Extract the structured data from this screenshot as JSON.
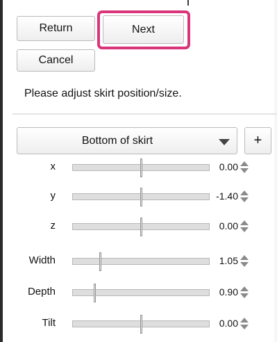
{
  "buttons": {
    "return_label": "Return",
    "next_label": "Next",
    "cancel_label": "Cancel",
    "add_label": "+"
  },
  "message": "Please adjust skirt position/size.",
  "part_selector": {
    "selected": "Bottom of skirt"
  },
  "sliders": [
    {
      "label": "x",
      "value": "0.00",
      "position": 0.5
    },
    {
      "label": "y",
      "value": "-1.40",
      "position": 0.5
    },
    {
      "label": "z",
      "value": "0.00",
      "position": 0.5
    },
    {
      "label": "Width",
      "value": "1.05",
      "position": 0.2
    },
    {
      "label": "Depth",
      "value": "0.90",
      "position": 0.16
    },
    {
      "label": "Tilt",
      "value": "0.00",
      "position": 0.5
    }
  ],
  "colors": {
    "highlight": "#d9357a"
  },
  "icons": {
    "dropdown": "chevron-down-icon",
    "spinner": "up-down-arrows-icon"
  }
}
